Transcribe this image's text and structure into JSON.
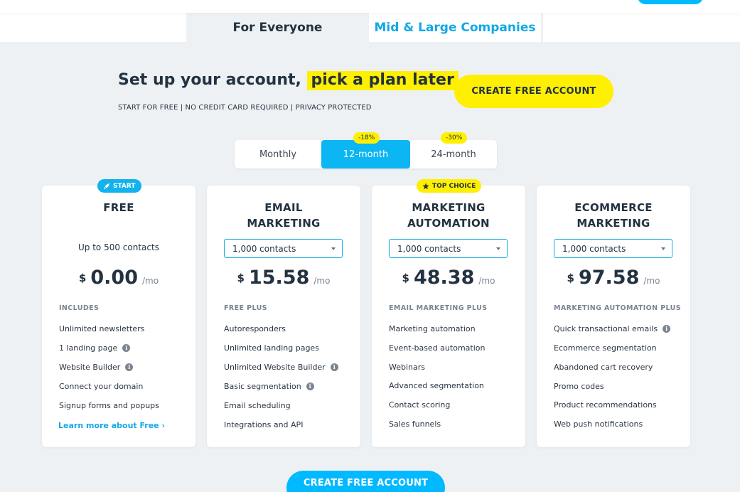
{
  "nav": {
    "tabs": [
      {
        "label": "For Everyone"
      },
      {
        "label": "Mid & Large Companies"
      }
    ]
  },
  "hero": {
    "title_start": "Set up your account, ",
    "title_highlight": "pick a plan later",
    "subtitle": "START FOR FREE | NO CREDIT CARD REQUIRED | PRIVACY PROTECTED",
    "cta_label": "CREATE FREE ACCOUNT"
  },
  "billing": {
    "options": [
      {
        "label": "Monthly",
        "discount": ""
      },
      {
        "label": "12-month",
        "discount": "-18%"
      },
      {
        "label": "24-month",
        "discount": "-30%"
      }
    ],
    "selected": "12-month"
  },
  "plans": [
    {
      "badge": "START",
      "title_lines": [
        "FREE"
      ],
      "contacts": "Up to 500 contacts",
      "currency": "$",
      "price": "0.00",
      "period": "/mo",
      "features_heading": "INCLUDES",
      "features": [
        {
          "label": "Unlimited newsletters",
          "info": false
        },
        {
          "label": "1 landing page",
          "info": true
        },
        {
          "label": "Website Builder",
          "info": true
        },
        {
          "label": "Connect your domain",
          "info": false
        },
        {
          "label": "Signup forms and popups",
          "info": false
        }
      ],
      "link": "Learn more about Free ›"
    },
    {
      "title_lines": [
        "EMAIL",
        "MARKETING"
      ],
      "contacts": "1,000 contacts",
      "currency": "$",
      "price": "15.58",
      "period": "/mo",
      "features_heading": "FREE PLUS",
      "features": [
        {
          "label": "Autoresponders",
          "info": false
        },
        {
          "label": "Unlimited landing pages",
          "info": false
        },
        {
          "label": "Unlimited Website Builder",
          "info": true
        },
        {
          "label": "Basic segmentation",
          "info": true
        },
        {
          "label": "Email scheduling",
          "info": false
        },
        {
          "label": "Integrations and API",
          "info": false
        }
      ]
    },
    {
      "badge": "TOP CHOICE",
      "title_lines": [
        "MARKETING",
        "AUTOMATION"
      ],
      "contacts": "1,000 contacts",
      "currency": "$",
      "price": "48.38",
      "period": "/mo",
      "features_heading": "EMAIL MARKETING PLUS",
      "features": [
        {
          "label": "Marketing automation",
          "info": false
        },
        {
          "label": "Event-based automation",
          "info": false
        },
        {
          "label": "Webinars",
          "info": false
        },
        {
          "label": "Advanced segmentation",
          "info": false
        },
        {
          "label": "Contact scoring",
          "info": false
        },
        {
          "label": "Sales funnels",
          "info": false
        }
      ]
    },
    {
      "title_lines": [
        "ECOMMERCE",
        "MARKETING"
      ],
      "contacts": "1,000 contacts",
      "currency": "$",
      "price": "97.58",
      "period": "/mo",
      "features_heading": "MARKETING AUTOMATION PLUS",
      "features": [
        {
          "label": "Quick transactional emails",
          "info": true
        },
        {
          "label": "Ecommerce segmentation",
          "info": false
        },
        {
          "label": "Abandoned cart recovery",
          "info": false
        },
        {
          "label": "Promo codes",
          "info": false
        },
        {
          "label": "Product recommendations",
          "info": false
        },
        {
          "label": "Web push notifications",
          "info": false
        }
      ]
    }
  ],
  "footer": {
    "cta_label": "CREATE FREE ACCOUNT"
  },
  "icons": {
    "info": "info-icon",
    "rocket": "rocket-icon",
    "star": "star-icon",
    "chevron": "chevron-down-icon"
  },
  "colors": {
    "accent_blue": "#0cb6f3",
    "highlight_yellow": "#ffef00",
    "background": "#eef1f4"
  }
}
